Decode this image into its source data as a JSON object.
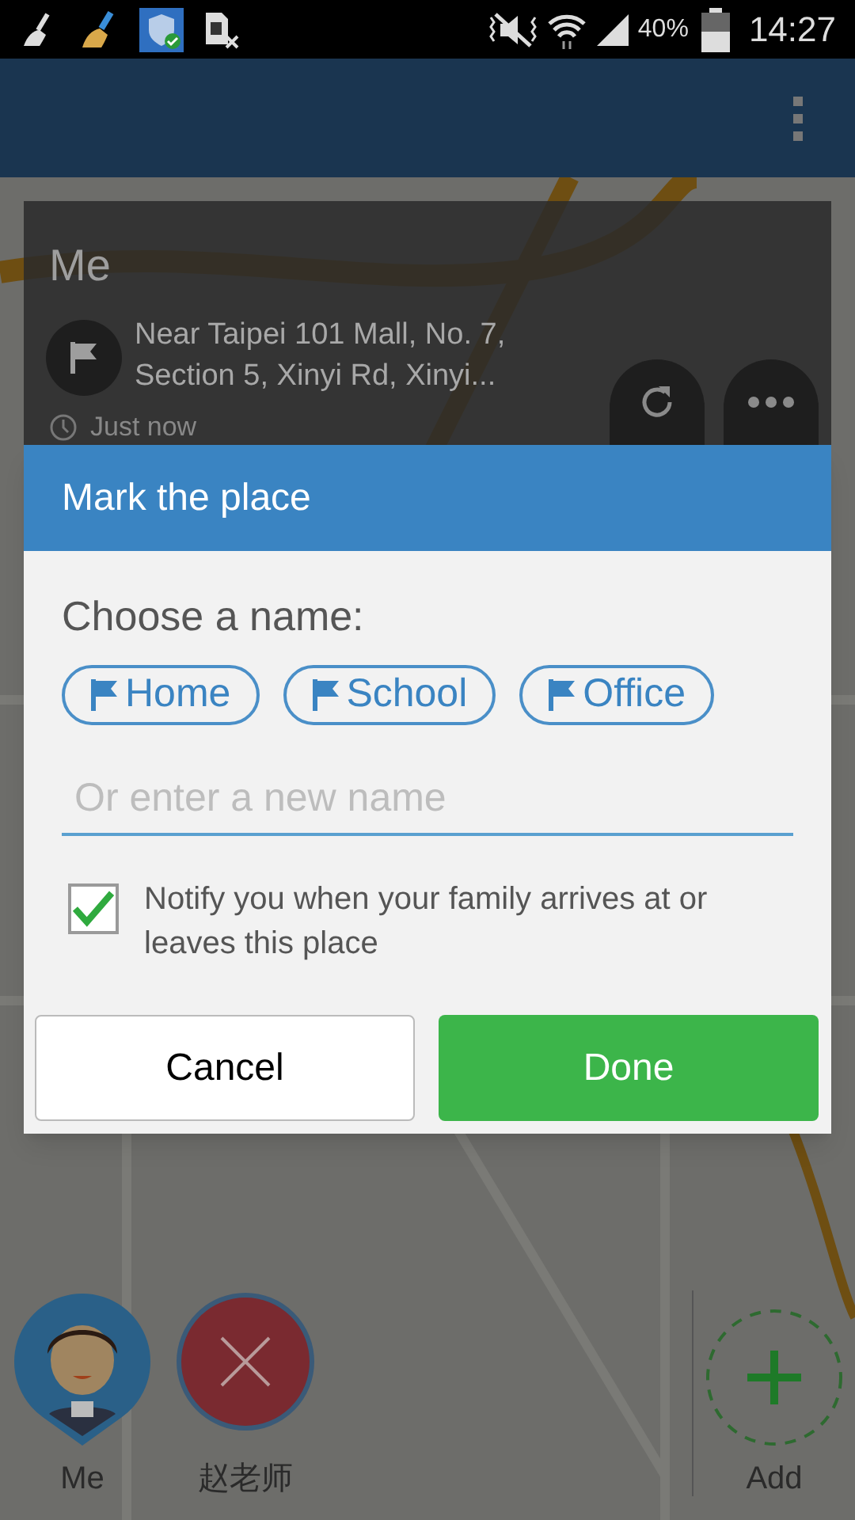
{
  "status_bar": {
    "battery": "40%",
    "time": "14:27"
  },
  "location_card": {
    "title": "Me",
    "address": "Near Taipei 101 Mall, No. 7, Section 5, Xinyi Rd, Xinyi...",
    "time": "Just now"
  },
  "dialog": {
    "title": "Mark the place",
    "prompt": "Choose a name:",
    "chips": [
      {
        "label": "Home"
      },
      {
        "label": "School"
      },
      {
        "label": "Office"
      }
    ],
    "name_field": {
      "placeholder": "Or enter a new name"
    },
    "notify": {
      "label": "Notify you when your family arrives at or leaves this place",
      "checked": true
    },
    "buttons": [
      {
        "label": "Cancel",
        "kind": "secondary"
      },
      {
        "label": "Done",
        "kind": "primary"
      }
    ]
  },
  "people": [
    {
      "name": "Me",
      "kind": "avatar"
    },
    {
      "name": "赵老师",
      "kind": "error"
    }
  ],
  "add": {
    "label": "Add"
  }
}
